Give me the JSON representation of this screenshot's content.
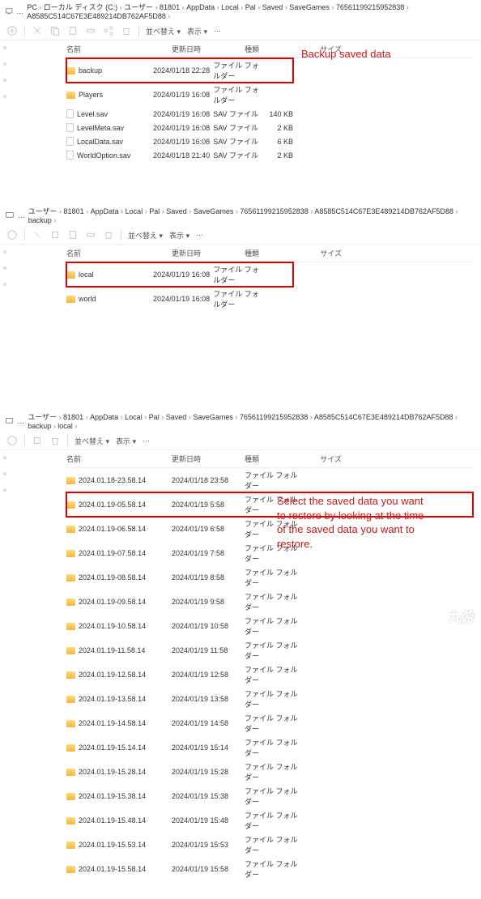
{
  "toolbar": {
    "sort": "並べ替え",
    "view": "表示"
  },
  "headers": {
    "name": "名前",
    "date": "更新日時",
    "type": "種類",
    "size": "サイズ"
  },
  "panel1": {
    "breadcrumb": [
      "PC",
      "ローカル ディスク (C:)",
      "ユーザー",
      "81801",
      "AppData",
      "Local",
      "Pal",
      "Saved",
      "SaveGames",
      "76561199215952838",
      "A8585C514C67E3E489214DB762AF5D88"
    ],
    "annotation": "Backup saved data",
    "rows": [
      {
        "name": "backup",
        "date": "2024/01/18 22:28",
        "type": "ファイル フォルダー",
        "size": "",
        "icon": "folder",
        "hl": true
      },
      {
        "name": "Players",
        "date": "2024/01/19 16:08",
        "type": "ファイル フォルダー",
        "size": "",
        "icon": "folder"
      },
      {
        "name": "Level.sav",
        "date": "2024/01/19 16:08",
        "type": "SAV ファイル",
        "size": "140 KB",
        "icon": "file"
      },
      {
        "name": "LevelMeta.sav",
        "date": "2024/01/19 16:08",
        "type": "SAV ファイル",
        "size": "2 KB",
        "icon": "file"
      },
      {
        "name": "LocalData.sav",
        "date": "2024/01/19 16:08",
        "type": "SAV ファイル",
        "size": "6 KB",
        "icon": "file"
      },
      {
        "name": "WorldOption.sav",
        "date": "2024/01/18 21:40",
        "type": "SAV ファイル",
        "size": "2 KB",
        "icon": "file"
      }
    ]
  },
  "panel2": {
    "breadcrumb": [
      "ユーザー",
      "81801",
      "AppData",
      "Local",
      "Pal",
      "Saved",
      "SaveGames",
      "76561199215952838",
      "A8585C514C67E3E489214DB762AF5D88",
      "backup"
    ],
    "rows": [
      {
        "name": "local",
        "date": "2024/01/19 16:08",
        "type": "ファイル フォルダー",
        "size": "",
        "icon": "folder",
        "hl": true
      },
      {
        "name": "world",
        "date": "2024/01/19 16:08",
        "type": "ファイル フォルダー",
        "size": "",
        "icon": "folder"
      }
    ]
  },
  "panel3": {
    "breadcrumb": [
      "ユーザー",
      "81801",
      "AppData",
      "Local",
      "Pal",
      "Saved",
      "SaveGames",
      "76561199215952838",
      "A8585C514C67E3E489214DB762AF5D88",
      "backup",
      "local"
    ],
    "annotation": "Select the saved data you want to restore by looking at the time of the saved data you want to restore.",
    "rows": [
      {
        "name": "2024.01.18-23.58.14",
        "date": "2024/01/18 23:58",
        "type": "ファイル フォルダー",
        "size": "",
        "icon": "folder"
      },
      {
        "name": "2024.01.19-05.58.14",
        "date": "2024/01/19 5:58",
        "type": "ファイル フォルダー",
        "size": "",
        "icon": "folder",
        "hl": true
      },
      {
        "name": "2024.01.19-06.58.14",
        "date": "2024/01/19 6:58",
        "type": "ファイル フォルダー",
        "size": "",
        "icon": "folder"
      },
      {
        "name": "2024.01.19-07.58.14",
        "date": "2024/01/19 7:58",
        "type": "ファイル フォルダー",
        "size": "",
        "icon": "folder"
      },
      {
        "name": "2024.01.19-08.58.14",
        "date": "2024/01/19 8:58",
        "type": "ファイル フォルダー",
        "size": "",
        "icon": "folder"
      },
      {
        "name": "2024.01.19-09.58.14",
        "date": "2024/01/19 9:58",
        "type": "ファイル フォルダー",
        "size": "",
        "icon": "folder"
      },
      {
        "name": "2024.01.19-10.58.14",
        "date": "2024/01/19 10:58",
        "type": "ファイル フォルダー",
        "size": "",
        "icon": "folder"
      },
      {
        "name": "2024.01.19-11.58.14",
        "date": "2024/01/19 11:58",
        "type": "ファイル フォルダー",
        "size": "",
        "icon": "folder"
      },
      {
        "name": "2024.01.19-12.58.14",
        "date": "2024/01/19 12:58",
        "type": "ファイル フォルダー",
        "size": "",
        "icon": "folder"
      },
      {
        "name": "2024.01.19-13.58.14",
        "date": "2024/01/19 13:58",
        "type": "ファイル フォルダー",
        "size": "",
        "icon": "folder"
      },
      {
        "name": "2024.01.19-14.58.14",
        "date": "2024/01/19 14:58",
        "type": "ファイル フォルダー",
        "size": "",
        "icon": "folder"
      },
      {
        "name": "2024.01.19-15.14.14",
        "date": "2024/01/19 15:14",
        "type": "ファイル フォルダー",
        "size": "",
        "icon": "folder"
      },
      {
        "name": "2024.01.19-15.28.14",
        "date": "2024/01/19 15:28",
        "type": "ファイル フォルダー",
        "size": "",
        "icon": "folder"
      },
      {
        "name": "2024.01.19-15.38.14",
        "date": "2024/01/19 15:38",
        "type": "ファイル フォルダー",
        "size": "",
        "icon": "folder"
      },
      {
        "name": "2024.01.19-15.48.14",
        "date": "2024/01/19 15:48",
        "type": "ファイル フォルダー",
        "size": "",
        "icon": "folder"
      },
      {
        "name": "2024.01.19-15.53.14",
        "date": "2024/01/19 15:53",
        "type": "ファイル フォルダー",
        "size": "",
        "icon": "folder"
      },
      {
        "name": "2024.01.19-15.58.14",
        "date": "2024/01/19 15:58",
        "type": "ファイル フォルダー",
        "size": "",
        "icon": "folder"
      }
    ]
  },
  "watermark": "九游"
}
